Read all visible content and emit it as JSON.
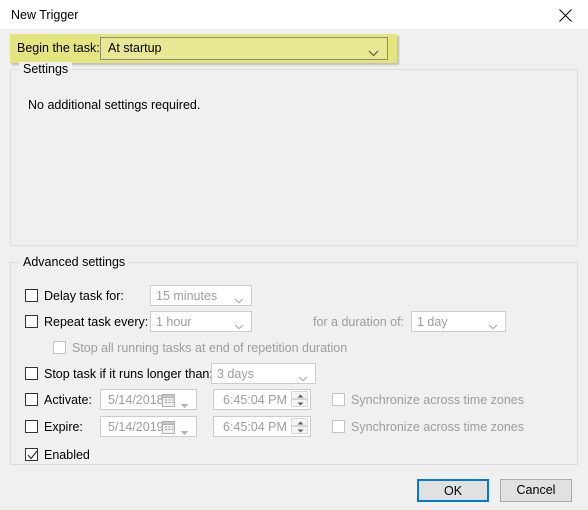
{
  "window": {
    "title": "New Trigger",
    "close_icon": "close-icon"
  },
  "top_row": {
    "label": "Begin the task:",
    "combo_value": "At startup",
    "highlight_color": "#e5e580",
    "chevron_icon": "chevron-down-icon"
  },
  "settings_group": {
    "title": "Settings",
    "note": "No additional settings required."
  },
  "advanced_group": {
    "title": "Advanced settings",
    "rows": {
      "delay": {
        "label": "Delay task for:",
        "checked": false,
        "combo_value": "15 minutes"
      },
      "repeat": {
        "label": "Repeat task every:",
        "checked": false,
        "combo_value": "1 hour",
        "duration_label": "for a duration of:",
        "duration_value": "1 day"
      },
      "stop_all": {
        "label": "Stop all running tasks at end of repetition duration",
        "checked": false
      },
      "stop_longer": {
        "label": "Stop task if it runs longer than:",
        "checked": false,
        "combo_value": "3 days"
      },
      "activate": {
        "label": "Activate:",
        "checked": false,
        "date_value": "5/14/2018",
        "time_value": "6:45:04 PM",
        "sync_label": "Synchronize across time zones",
        "sync_checked": false
      },
      "expire": {
        "label": "Expire:",
        "checked": false,
        "date_value": "5/14/2019",
        "time_value": "6:45:04 PM",
        "sync_label": "Synchronize across time zones",
        "sync_checked": false
      },
      "enabled": {
        "label": "Enabled",
        "checked": true
      }
    }
  },
  "footer": {
    "ok_label": "OK",
    "cancel_label": "Cancel",
    "default_button_color": "#0078d7"
  }
}
